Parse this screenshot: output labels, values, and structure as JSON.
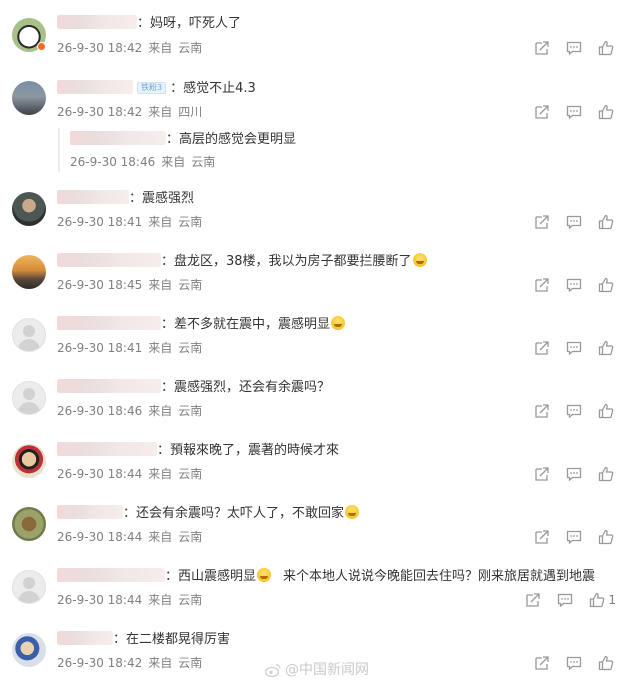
{
  "icons": {
    "share": "share-icon",
    "comment": "comment-icon",
    "like": "thumbs-up-icon"
  },
  "colors": {
    "meta": "#808080",
    "badge": "#f26b2a",
    "name_redaction": "#efdede"
  },
  "comments": [
    {
      "text": "妈呀，吓死人了",
      "date": "26-9-30 18:42",
      "from": "来自",
      "location": "云南",
      "like_count": ""
    },
    {
      "vip_label": "铁粉3",
      "text": "感觉不止4.3",
      "date": "26-9-30 18:42",
      "from": "来自",
      "location": "四川",
      "like_count": ""
    },
    {
      "text": "震感强烈",
      "date": "26-9-30 18:41",
      "from": "来自",
      "location": "云南",
      "like_count": ""
    },
    {
      "text": "盘龙区，38楼，我以为房子都要拦腰断了",
      "date": "26-9-30 18:45",
      "from": "来自",
      "location": "云南",
      "like_count": ""
    },
    {
      "text": "差不多就在震中，震感明显",
      "date": "26-9-30 18:41",
      "from": "来自",
      "location": "云南",
      "like_count": ""
    },
    {
      "text": "震感强烈，还会有余震吗？",
      "date": "26-9-30 18:46",
      "from": "来自",
      "location": "云南",
      "like_count": ""
    },
    {
      "text": "預報來晚了，震著的時候才來",
      "date": "26-9-30 18:44",
      "from": "来自",
      "location": "云南",
      "like_count": ""
    },
    {
      "text": "还会有余震吗？太吓人了，不敢回家",
      "date": "26-9-30 18:44",
      "from": "来自",
      "location": "云南",
      "like_count": ""
    },
    {
      "text": "西山震感明显",
      "text2": "来个本地人说说今晚能回去住吗？刚来旅居就遇到地震",
      "date": "26-9-30 18:44",
      "from": "来自",
      "location": "云南",
      "like_count": "1"
    },
    {
      "text": "在二楼都晃得厉害",
      "date": "26-9-30 18:42",
      "from": "来自",
      "location": "云南",
      "like_count": ""
    }
  ],
  "reply": {
    "text": "高层的感觉会更明显",
    "date": "26-9-30 18:46",
    "from": "来自",
    "location": "云南"
  },
  "watermark": {
    "text": "@中国新闻网"
  }
}
